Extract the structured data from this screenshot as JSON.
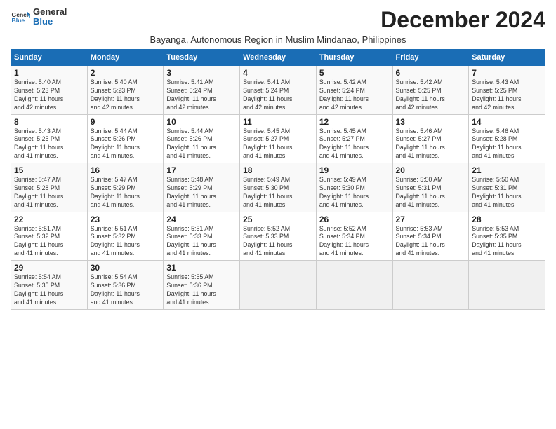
{
  "header": {
    "logo_line1": "General",
    "logo_line2": "Blue",
    "month_year": "December 2024",
    "subtitle": "Bayanga, Autonomous Region in Muslim Mindanao, Philippines"
  },
  "columns": [
    "Sunday",
    "Monday",
    "Tuesday",
    "Wednesday",
    "Thursday",
    "Friday",
    "Saturday"
  ],
  "weeks": [
    [
      {
        "day": "1",
        "info": "Sunrise: 5:40 AM\nSunset: 5:23 PM\nDaylight: 11 hours\nand 42 minutes."
      },
      {
        "day": "2",
        "info": "Sunrise: 5:40 AM\nSunset: 5:23 PM\nDaylight: 11 hours\nand 42 minutes."
      },
      {
        "day": "3",
        "info": "Sunrise: 5:41 AM\nSunset: 5:24 PM\nDaylight: 11 hours\nand 42 minutes."
      },
      {
        "day": "4",
        "info": "Sunrise: 5:41 AM\nSunset: 5:24 PM\nDaylight: 11 hours\nand 42 minutes."
      },
      {
        "day": "5",
        "info": "Sunrise: 5:42 AM\nSunset: 5:24 PM\nDaylight: 11 hours\nand 42 minutes."
      },
      {
        "day": "6",
        "info": "Sunrise: 5:42 AM\nSunset: 5:25 PM\nDaylight: 11 hours\nand 42 minutes."
      },
      {
        "day": "7",
        "info": "Sunrise: 5:43 AM\nSunset: 5:25 PM\nDaylight: 11 hours\nand 42 minutes."
      }
    ],
    [
      {
        "day": "8",
        "info": "Sunrise: 5:43 AM\nSunset: 5:25 PM\nDaylight: 11 hours\nand 41 minutes."
      },
      {
        "day": "9",
        "info": "Sunrise: 5:44 AM\nSunset: 5:26 PM\nDaylight: 11 hours\nand 41 minutes."
      },
      {
        "day": "10",
        "info": "Sunrise: 5:44 AM\nSunset: 5:26 PM\nDaylight: 11 hours\nand 41 minutes."
      },
      {
        "day": "11",
        "info": "Sunrise: 5:45 AM\nSunset: 5:27 PM\nDaylight: 11 hours\nand 41 minutes."
      },
      {
        "day": "12",
        "info": "Sunrise: 5:45 AM\nSunset: 5:27 PM\nDaylight: 11 hours\nand 41 minutes."
      },
      {
        "day": "13",
        "info": "Sunrise: 5:46 AM\nSunset: 5:27 PM\nDaylight: 11 hours\nand 41 minutes."
      },
      {
        "day": "14",
        "info": "Sunrise: 5:46 AM\nSunset: 5:28 PM\nDaylight: 11 hours\nand 41 minutes."
      }
    ],
    [
      {
        "day": "15",
        "info": "Sunrise: 5:47 AM\nSunset: 5:28 PM\nDaylight: 11 hours\nand 41 minutes."
      },
      {
        "day": "16",
        "info": "Sunrise: 5:47 AM\nSunset: 5:29 PM\nDaylight: 11 hours\nand 41 minutes."
      },
      {
        "day": "17",
        "info": "Sunrise: 5:48 AM\nSunset: 5:29 PM\nDaylight: 11 hours\nand 41 minutes."
      },
      {
        "day": "18",
        "info": "Sunrise: 5:49 AM\nSunset: 5:30 PM\nDaylight: 11 hours\nand 41 minutes."
      },
      {
        "day": "19",
        "info": "Sunrise: 5:49 AM\nSunset: 5:30 PM\nDaylight: 11 hours\nand 41 minutes."
      },
      {
        "day": "20",
        "info": "Sunrise: 5:50 AM\nSunset: 5:31 PM\nDaylight: 11 hours\nand 41 minutes."
      },
      {
        "day": "21",
        "info": "Sunrise: 5:50 AM\nSunset: 5:31 PM\nDaylight: 11 hours\nand 41 minutes."
      }
    ],
    [
      {
        "day": "22",
        "info": "Sunrise: 5:51 AM\nSunset: 5:32 PM\nDaylight: 11 hours\nand 41 minutes."
      },
      {
        "day": "23",
        "info": "Sunrise: 5:51 AM\nSunset: 5:32 PM\nDaylight: 11 hours\nand 41 minutes."
      },
      {
        "day": "24",
        "info": "Sunrise: 5:51 AM\nSunset: 5:33 PM\nDaylight: 11 hours\nand 41 minutes."
      },
      {
        "day": "25",
        "info": "Sunrise: 5:52 AM\nSunset: 5:33 PM\nDaylight: 11 hours\nand 41 minutes."
      },
      {
        "day": "26",
        "info": "Sunrise: 5:52 AM\nSunset: 5:34 PM\nDaylight: 11 hours\nand 41 minutes."
      },
      {
        "day": "27",
        "info": "Sunrise: 5:53 AM\nSunset: 5:34 PM\nDaylight: 11 hours\nand 41 minutes."
      },
      {
        "day": "28",
        "info": "Sunrise: 5:53 AM\nSunset: 5:35 PM\nDaylight: 11 hours\nand 41 minutes."
      }
    ],
    [
      {
        "day": "29",
        "info": "Sunrise: 5:54 AM\nSunset: 5:35 PM\nDaylight: 11 hours\nand 41 minutes."
      },
      {
        "day": "30",
        "info": "Sunrise: 5:54 AM\nSunset: 5:36 PM\nDaylight: 11 hours\nand 41 minutes."
      },
      {
        "day": "31",
        "info": "Sunrise: 5:55 AM\nSunset: 5:36 PM\nDaylight: 11 hours\nand 41 minutes."
      },
      {
        "day": "",
        "info": ""
      },
      {
        "day": "",
        "info": ""
      },
      {
        "day": "",
        "info": ""
      },
      {
        "day": "",
        "info": ""
      }
    ]
  ]
}
